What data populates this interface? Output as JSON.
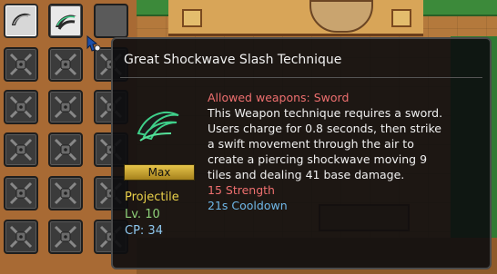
{
  "tooltip": {
    "title": "Great Shockwave Slash Technique",
    "badge": "Max",
    "type": "Projectile",
    "level": "Lv. 10",
    "cp": "CP: 34",
    "allowed": "Allowed weapons: Sword",
    "description": [
      "This Weapon technique requires a sword.",
      "Users charge for 0.8 seconds, then strike",
      "a swift movement through the air to",
      "create a piercing shockwave moving 9",
      "tiles and dealing 41 base damage."
    ],
    "requirement": "15 Strength",
    "cooldown": "21s Cooldown"
  },
  "colors": {
    "allowed": "#ee6f6f",
    "type": "#e9d04a",
    "level": "#8fd27a",
    "cp": "#8fc8ef",
    "cooldown": "#6fb7e8",
    "badge": "#d9b63a"
  },
  "inventory": {
    "top_row": [
      {
        "icon": "crescent-slash-icon",
        "state": "equipped"
      },
      {
        "icon": "shockwave-slash-icon",
        "state": "selected"
      },
      {
        "icon": "empty-slot",
        "state": "empty"
      }
    ],
    "locked_icon": "locked-chain-icon",
    "locked_rows": 5,
    "locked_columns": 3
  }
}
